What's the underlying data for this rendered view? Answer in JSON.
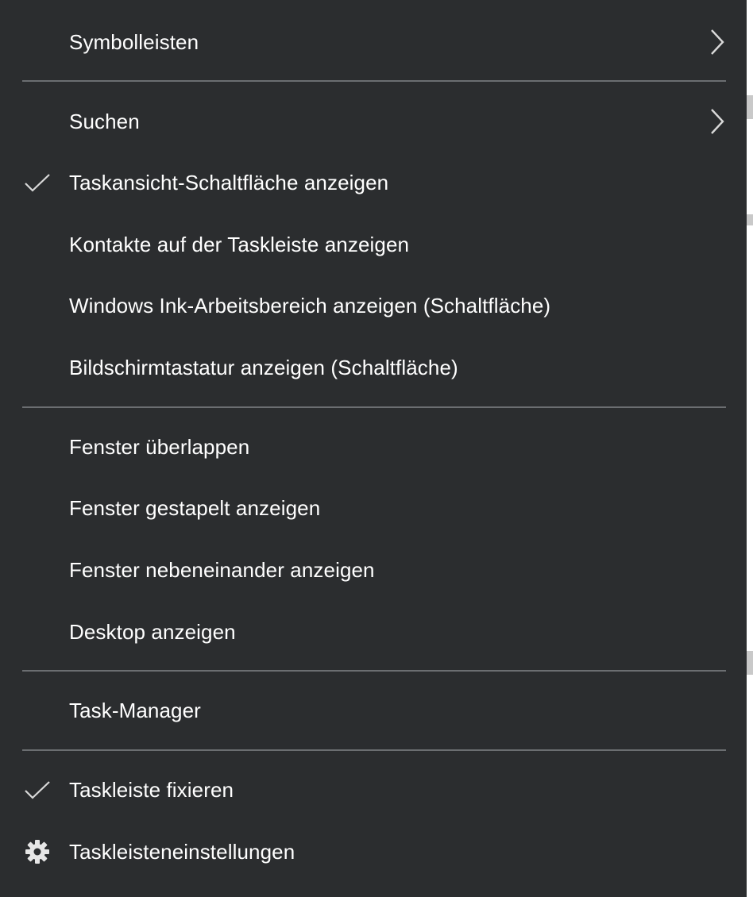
{
  "menu": {
    "items": [
      {
        "label": "Symbolleisten",
        "submenu": true
      },
      {
        "label": "Suchen",
        "submenu": true
      },
      {
        "label": "Taskansicht-Schaltfläche anzeigen",
        "checked": true
      },
      {
        "label": "Kontakte auf der Taskleiste anzeigen"
      },
      {
        "label": "Windows Ink-Arbeitsbereich anzeigen (Schaltfläche)"
      },
      {
        "label": "Bildschirmtastatur anzeigen (Schaltfläche)"
      },
      {
        "label": "Fenster überlappen"
      },
      {
        "label": "Fenster gestapelt anzeigen"
      },
      {
        "label": "Fenster nebeneinander anzeigen"
      },
      {
        "label": "Desktop anzeigen"
      },
      {
        "label": "Task-Manager"
      },
      {
        "label": "Taskleiste fixieren",
        "checked": true
      },
      {
        "label": "Taskleisteneinstellungen",
        "icon": "gear-icon"
      }
    ]
  },
  "colors": {
    "menu_background": "#2b2d2f",
    "separator": "#6b6e71",
    "text": "#ffffff",
    "glyph": "#d9d9d9"
  }
}
